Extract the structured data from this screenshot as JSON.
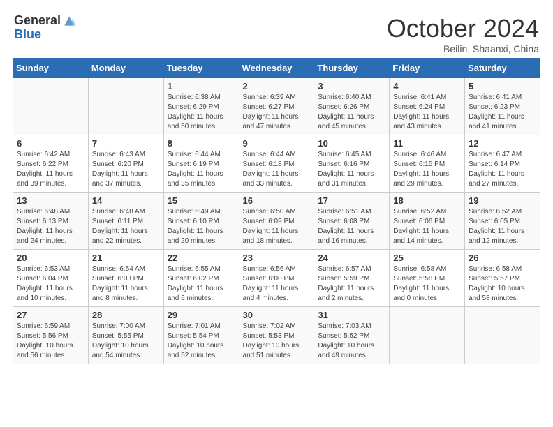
{
  "header": {
    "logo_general": "General",
    "logo_blue": "Blue",
    "month": "October 2024",
    "location": "Beilin, Shaanxi, China"
  },
  "days_of_week": [
    "Sunday",
    "Monday",
    "Tuesday",
    "Wednesday",
    "Thursday",
    "Friday",
    "Saturday"
  ],
  "weeks": [
    [
      {
        "day": "",
        "sunrise": "",
        "sunset": "",
        "daylight": ""
      },
      {
        "day": "",
        "sunrise": "",
        "sunset": "",
        "daylight": ""
      },
      {
        "day": "1",
        "sunrise": "Sunrise: 6:38 AM",
        "sunset": "Sunset: 6:29 PM",
        "daylight": "Daylight: 11 hours and 50 minutes."
      },
      {
        "day": "2",
        "sunrise": "Sunrise: 6:39 AM",
        "sunset": "Sunset: 6:27 PM",
        "daylight": "Daylight: 11 hours and 47 minutes."
      },
      {
        "day": "3",
        "sunrise": "Sunrise: 6:40 AM",
        "sunset": "Sunset: 6:26 PM",
        "daylight": "Daylight: 11 hours and 45 minutes."
      },
      {
        "day": "4",
        "sunrise": "Sunrise: 6:41 AM",
        "sunset": "Sunset: 6:24 PM",
        "daylight": "Daylight: 11 hours and 43 minutes."
      },
      {
        "day": "5",
        "sunrise": "Sunrise: 6:41 AM",
        "sunset": "Sunset: 6:23 PM",
        "daylight": "Daylight: 11 hours and 41 minutes."
      }
    ],
    [
      {
        "day": "6",
        "sunrise": "Sunrise: 6:42 AM",
        "sunset": "Sunset: 6:22 PM",
        "daylight": "Daylight: 11 hours and 39 minutes."
      },
      {
        "day": "7",
        "sunrise": "Sunrise: 6:43 AM",
        "sunset": "Sunset: 6:20 PM",
        "daylight": "Daylight: 11 hours and 37 minutes."
      },
      {
        "day": "8",
        "sunrise": "Sunrise: 6:44 AM",
        "sunset": "Sunset: 6:19 PM",
        "daylight": "Daylight: 11 hours and 35 minutes."
      },
      {
        "day": "9",
        "sunrise": "Sunrise: 6:44 AM",
        "sunset": "Sunset: 6:18 PM",
        "daylight": "Daylight: 11 hours and 33 minutes."
      },
      {
        "day": "10",
        "sunrise": "Sunrise: 6:45 AM",
        "sunset": "Sunset: 6:16 PM",
        "daylight": "Daylight: 11 hours and 31 minutes."
      },
      {
        "day": "11",
        "sunrise": "Sunrise: 6:46 AM",
        "sunset": "Sunset: 6:15 PM",
        "daylight": "Daylight: 11 hours and 29 minutes."
      },
      {
        "day": "12",
        "sunrise": "Sunrise: 6:47 AM",
        "sunset": "Sunset: 6:14 PM",
        "daylight": "Daylight: 11 hours and 27 minutes."
      }
    ],
    [
      {
        "day": "13",
        "sunrise": "Sunrise: 6:48 AM",
        "sunset": "Sunset: 6:13 PM",
        "daylight": "Daylight: 11 hours and 24 minutes."
      },
      {
        "day": "14",
        "sunrise": "Sunrise: 6:48 AM",
        "sunset": "Sunset: 6:11 PM",
        "daylight": "Daylight: 11 hours and 22 minutes."
      },
      {
        "day": "15",
        "sunrise": "Sunrise: 6:49 AM",
        "sunset": "Sunset: 6:10 PM",
        "daylight": "Daylight: 11 hours and 20 minutes."
      },
      {
        "day": "16",
        "sunrise": "Sunrise: 6:50 AM",
        "sunset": "Sunset: 6:09 PM",
        "daylight": "Daylight: 11 hours and 18 minutes."
      },
      {
        "day": "17",
        "sunrise": "Sunrise: 6:51 AM",
        "sunset": "Sunset: 6:08 PM",
        "daylight": "Daylight: 11 hours and 16 minutes."
      },
      {
        "day": "18",
        "sunrise": "Sunrise: 6:52 AM",
        "sunset": "Sunset: 6:06 PM",
        "daylight": "Daylight: 11 hours and 14 minutes."
      },
      {
        "day": "19",
        "sunrise": "Sunrise: 6:52 AM",
        "sunset": "Sunset: 6:05 PM",
        "daylight": "Daylight: 11 hours and 12 minutes."
      }
    ],
    [
      {
        "day": "20",
        "sunrise": "Sunrise: 6:53 AM",
        "sunset": "Sunset: 6:04 PM",
        "daylight": "Daylight: 11 hours and 10 minutes."
      },
      {
        "day": "21",
        "sunrise": "Sunrise: 6:54 AM",
        "sunset": "Sunset: 6:03 PM",
        "daylight": "Daylight: 11 hours and 8 minutes."
      },
      {
        "day": "22",
        "sunrise": "Sunrise: 6:55 AM",
        "sunset": "Sunset: 6:02 PM",
        "daylight": "Daylight: 11 hours and 6 minutes."
      },
      {
        "day": "23",
        "sunrise": "Sunrise: 6:56 AM",
        "sunset": "Sunset: 6:00 PM",
        "daylight": "Daylight: 11 hours and 4 minutes."
      },
      {
        "day": "24",
        "sunrise": "Sunrise: 6:57 AM",
        "sunset": "Sunset: 5:59 PM",
        "daylight": "Daylight: 11 hours and 2 minutes."
      },
      {
        "day": "25",
        "sunrise": "Sunrise: 6:58 AM",
        "sunset": "Sunset: 5:58 PM",
        "daylight": "Daylight: 11 hours and 0 minutes."
      },
      {
        "day": "26",
        "sunrise": "Sunrise: 6:58 AM",
        "sunset": "Sunset: 5:57 PM",
        "daylight": "Daylight: 10 hours and 58 minutes."
      }
    ],
    [
      {
        "day": "27",
        "sunrise": "Sunrise: 6:59 AM",
        "sunset": "Sunset: 5:56 PM",
        "daylight": "Daylight: 10 hours and 56 minutes."
      },
      {
        "day": "28",
        "sunrise": "Sunrise: 7:00 AM",
        "sunset": "Sunset: 5:55 PM",
        "daylight": "Daylight: 10 hours and 54 minutes."
      },
      {
        "day": "29",
        "sunrise": "Sunrise: 7:01 AM",
        "sunset": "Sunset: 5:54 PM",
        "daylight": "Daylight: 10 hours and 52 minutes."
      },
      {
        "day": "30",
        "sunrise": "Sunrise: 7:02 AM",
        "sunset": "Sunset: 5:53 PM",
        "daylight": "Daylight: 10 hours and 51 minutes."
      },
      {
        "day": "31",
        "sunrise": "Sunrise: 7:03 AM",
        "sunset": "Sunset: 5:52 PM",
        "daylight": "Daylight: 10 hours and 49 minutes."
      },
      {
        "day": "",
        "sunrise": "",
        "sunset": "",
        "daylight": ""
      },
      {
        "day": "",
        "sunrise": "",
        "sunset": "",
        "daylight": ""
      }
    ]
  ]
}
